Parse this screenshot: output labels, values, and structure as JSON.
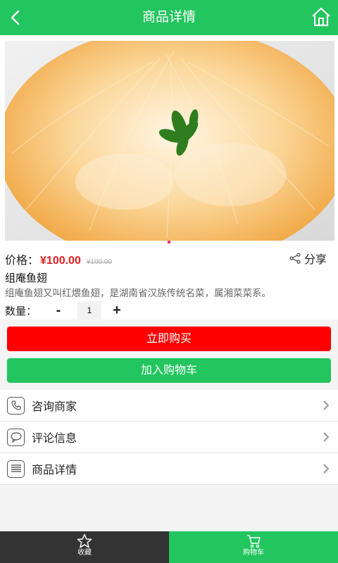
{
  "header": {
    "title": "商品详情"
  },
  "product": {
    "price_label": "价格：",
    "price": "¥100.00",
    "original_price": "¥100.00",
    "share_label": "分享",
    "name": "组庵鱼翅",
    "description": "组庵鱼翅又叫红煨鱼翅，是湖南省汉族传统名菜，属湘菜菜系。"
  },
  "quantity": {
    "label": "数量：",
    "minus": "-",
    "value": "1",
    "plus": "+"
  },
  "actions": {
    "buy_now": "立即购买",
    "add_to_cart": "加入购物车"
  },
  "menu": [
    {
      "label": "咨询商家",
      "icon": "phone-icon"
    },
    {
      "label": "评论信息",
      "icon": "comment-icon"
    },
    {
      "label": "商品详情",
      "icon": "details-icon"
    }
  ],
  "tabbar": {
    "favorite": "收藏",
    "cart": "购物车"
  },
  "colors": {
    "primary": "#22c55e",
    "buy": "#ff0000",
    "price": "#e02020",
    "tab_dark": "#333333"
  }
}
